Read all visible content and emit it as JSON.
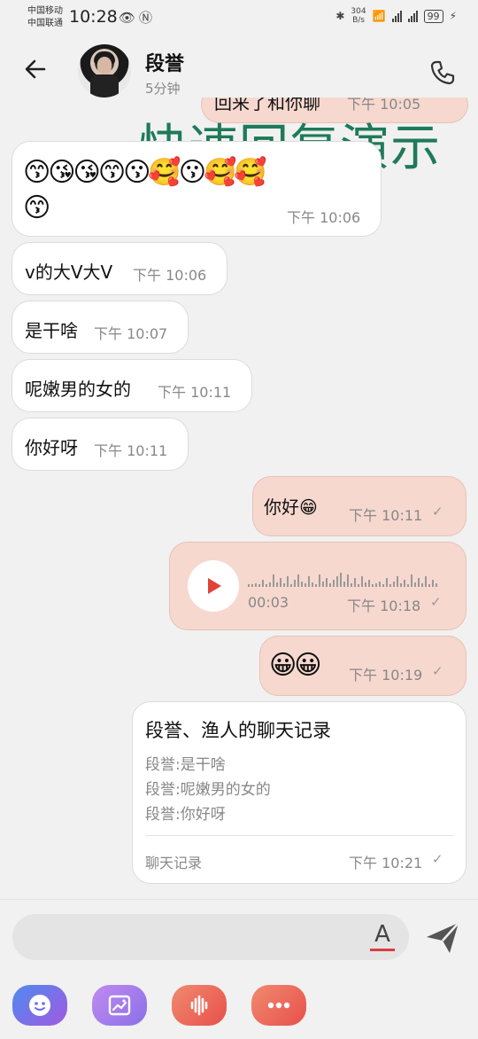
{
  "status_bar": {
    "carrier1": "中国移动",
    "carrier2": "中国联通",
    "time": "10:28",
    "speed_value": "304",
    "speed_unit": "B/s",
    "battery": "99"
  },
  "header": {
    "contact_name": "段誉",
    "last_seen": "5分钟",
    "avatar_icon": "user-avatar-photo",
    "back_icon": "arrow-left-icon",
    "call_icon": "phone-icon"
  },
  "overlay_title": "快速回复演示",
  "messages": [
    {
      "side": "out",
      "text": "回来了和你聊",
      "time": "下午 10:05"
    },
    {
      "side": "in",
      "text": "😙😘😘😙😗🥰😗🥰🥰",
      "text2": "😙",
      "time": "下午 10:06"
    },
    {
      "side": "in",
      "text": "v的大V大V",
      "time": "下午 10:06"
    },
    {
      "side": "in",
      "text": "是干啥",
      "time": "下午 10:07"
    },
    {
      "side": "in",
      "text": "呢嫩男的女的",
      "time": "下午 10:11"
    },
    {
      "side": "in",
      "text": "你好呀",
      "time": "下午 10:11"
    },
    {
      "side": "out",
      "text": "你好😁",
      "time": "下午 10:11"
    },
    {
      "side": "out",
      "type": "voice",
      "duration": "00:03",
      "time": "下午 10:18"
    },
    {
      "side": "out",
      "text": "😀😀",
      "time": "下午 10:19"
    }
  ],
  "chat_record": {
    "title": "段誉、渔人的聊天记录",
    "lines": [
      "段誉:是干啥",
      "段誉:呢嫩男的女的",
      "段誉:你好呀"
    ],
    "footer": "聊天记录",
    "time": "下午 10:21"
  },
  "input": {
    "placeholder": "",
    "font_button_label": "A",
    "send_icon": "send-icon"
  },
  "toolbar": {
    "items": [
      {
        "icon": "emoji-face-icon",
        "color": "#6a6cf0"
      },
      {
        "icon": "image-icon",
        "color": "#a07ae8"
      },
      {
        "icon": "voice-wave-icon",
        "color": "#ef6b5e"
      },
      {
        "icon": "more-dots-icon",
        "color": "#ef6b5e"
      }
    ]
  },
  "colors": {
    "outgoing_bubble": "#f6d8cf",
    "incoming_bubble": "#ffffff",
    "overlay_text": "#1f7a5a",
    "background": "#f1f1f1"
  }
}
